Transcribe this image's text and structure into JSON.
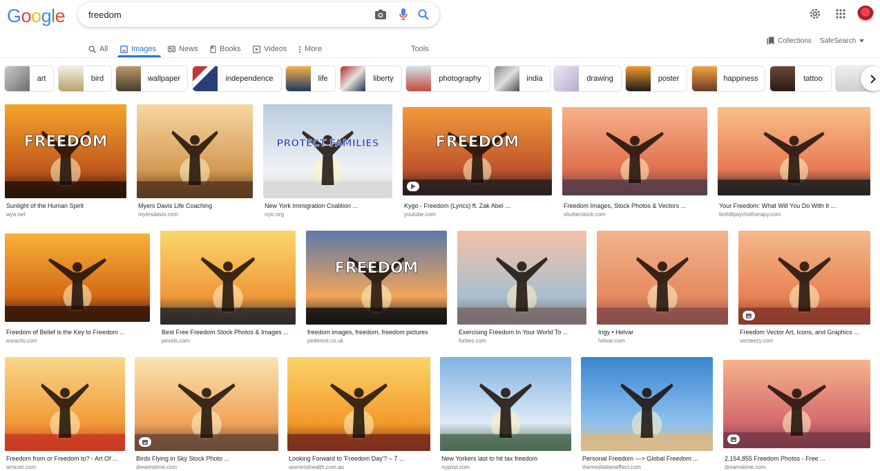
{
  "logo": "Google",
  "search": {
    "query": "freedom"
  },
  "nav": {
    "tabs": [
      {
        "label": "All",
        "icon": "search-icon"
      },
      {
        "label": "Images",
        "icon": "image-icon",
        "active": true
      },
      {
        "label": "News",
        "icon": "news-icon"
      },
      {
        "label": "Books",
        "icon": "book-icon"
      },
      {
        "label": "Videos",
        "icon": "video-icon"
      },
      {
        "label": "More",
        "icon": "more-vert-icon"
      }
    ],
    "tools": "Tools",
    "collections": "Collections",
    "safesearch": "SafeSearch"
  },
  "chips": [
    {
      "label": "art"
    },
    {
      "label": "bird"
    },
    {
      "label": "wallpaper"
    },
    {
      "label": "independence"
    },
    {
      "label": "life"
    },
    {
      "label": "liberty"
    },
    {
      "label": "photography"
    },
    {
      "label": "india"
    },
    {
      "label": "drawing"
    },
    {
      "label": "poster"
    },
    {
      "label": "happiness"
    },
    {
      "label": "tattoo"
    }
  ],
  "results": [
    {
      "title": "Sunlight of the Human Spirit",
      "source": "wya.net",
      "overlay": "FREEDOM"
    },
    {
      "title": "Myers Davis Life Coaching",
      "source": "myersdavis.com"
    },
    {
      "title": "New York Immigration Coalition ...",
      "source": "nyic.org",
      "overlay": "PROTECT FAMILIES"
    },
    {
      "title": "Kygo - Freedom (Lyrics) ft. Zak Abel ...",
      "source": "youtube.com",
      "overlay": "FREEDOM",
      "badge": "play"
    },
    {
      "title": "Freedom Images, Stock Photos & Vectors ...",
      "source": "shutterstock.com"
    },
    {
      "title": "Your Freedom: What Will You Do With It ...",
      "source": "timhillpsychotherapy.com"
    },
    {
      "title": "Freedom of Belief is the Key to Freedom ...",
      "source": "euractiv.com"
    },
    {
      "title": "Best Free Freedom Stock Photos & Images ...",
      "source": "pexels.com"
    },
    {
      "title": "freedom images, freedom, freedom pictures",
      "source": "pinterest.co.uk",
      "overlay": "FREEDOM"
    },
    {
      "title": "Exercising Freedom In Your World To ...",
      "source": "forbes.com"
    },
    {
      "title": "Ingy • Helvar",
      "source": "helvar.com"
    },
    {
      "title": "Freedom Vector Art, Icons, and Graphics ...",
      "source": "vecteezy.com",
      "badge": "image"
    },
    {
      "title": "Freedom from or Freedom to? - Art Of ...",
      "source": "amican.com"
    },
    {
      "title": "Birds Flying in Sky Stock Photo ...",
      "source": "dreamstime.com",
      "badge": "image"
    },
    {
      "title": "Looking Forward to 'Freedom Day'? – 7 ...",
      "source": "womenshealth.com.au"
    },
    {
      "title": "New Yorkers last to hit tax freedom",
      "source": "nypost.com"
    },
    {
      "title": "Personal Freedom —> Global Freedom ...",
      "source": "themeditationeffect.com"
    },
    {
      "title": "2,154,855 Freedom Photos - Free ...",
      "source": "dreamstime.com",
      "badge": "image"
    }
  ],
  "colors": {
    "accent": "#1a73e8",
    "text": "#202124",
    "muted": "#70757a"
  }
}
